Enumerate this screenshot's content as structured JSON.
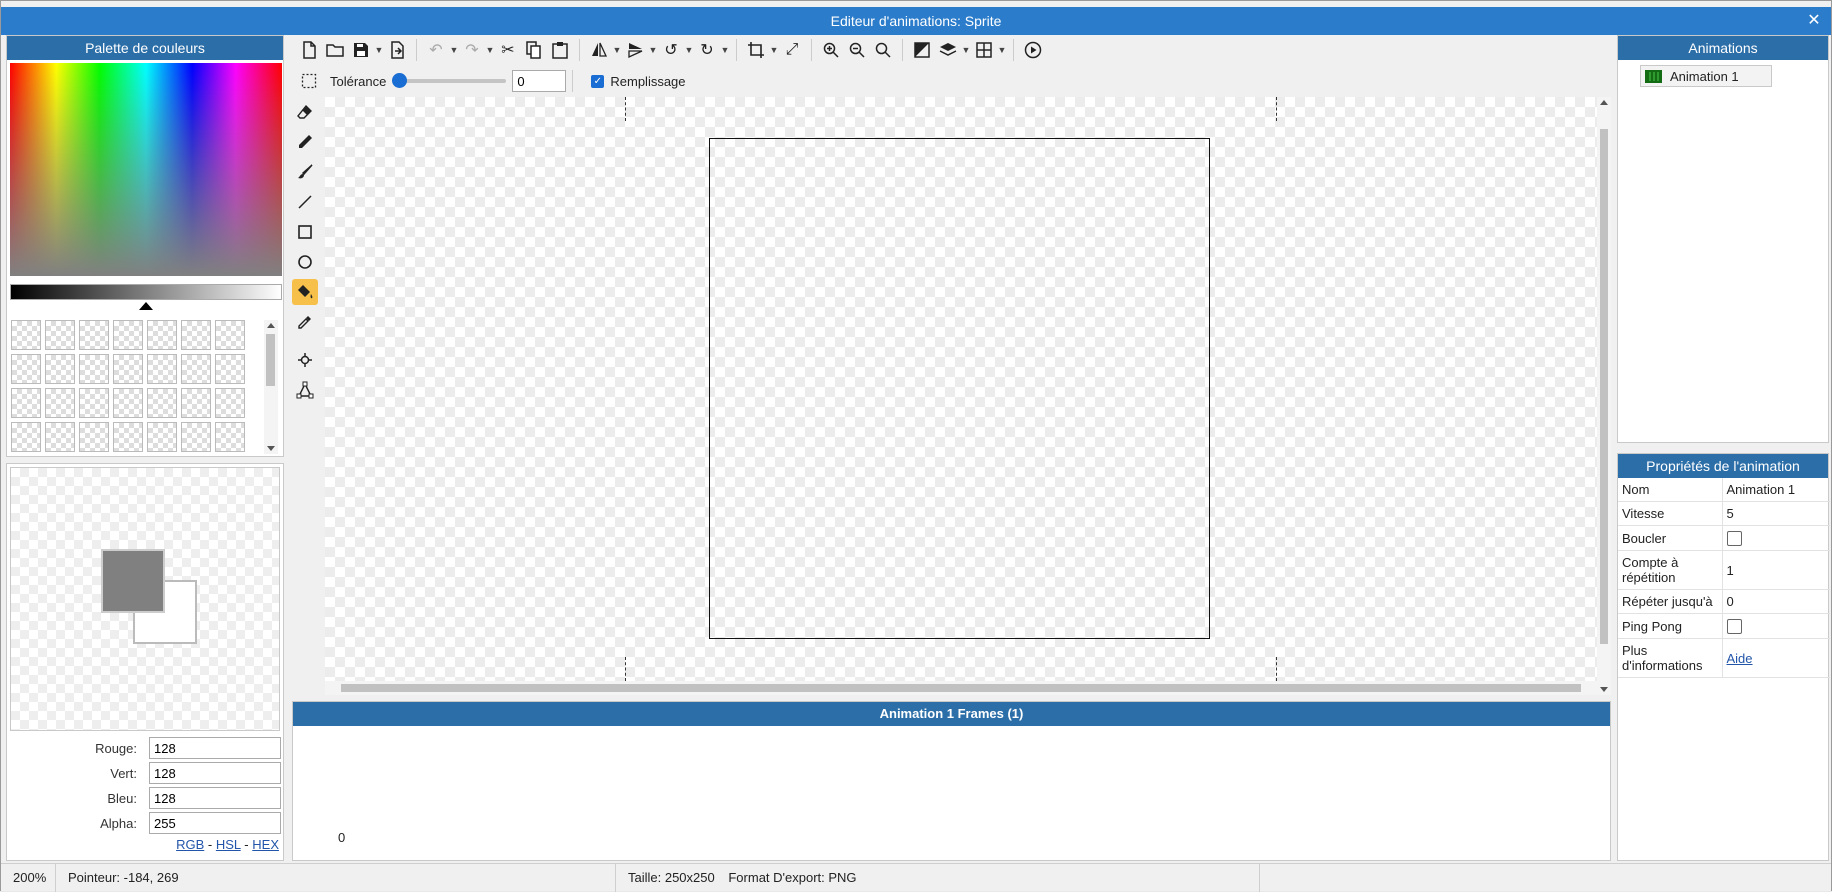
{
  "window": {
    "title": "Editeur d'animations: Sprite",
    "close": "✕"
  },
  "palette": {
    "title": "Palette de couleurs",
    "swatch_count": 28,
    "fields": [
      {
        "label": "Rouge:",
        "value": "128"
      },
      {
        "label": "Vert:",
        "value": "128"
      },
      {
        "label": "Bleu:",
        "value": "128"
      },
      {
        "label": "Alpha:",
        "value": "255"
      }
    ],
    "modes": {
      "rgb": "RGB",
      "hsl": "HSL",
      "hex": "HEX",
      "sep": "-"
    },
    "foreground_color": "#808080",
    "background_color": "#ffffff"
  },
  "toolbar": {
    "tolerance_label": "Tolérance",
    "tolerance_value": "0",
    "tolerance_fraction": 0,
    "fill_label": "Remplissage",
    "fill_checked": true
  },
  "frames": {
    "title": "Animation 1 Frames (1)",
    "index": "0"
  },
  "animations": {
    "title": "Animations",
    "items": [
      {
        "label": "Animation 1"
      }
    ]
  },
  "properties": {
    "title": "Propriétés de l'animation",
    "rows": {
      "name": {
        "key": "Nom",
        "value": "Animation 1"
      },
      "speed": {
        "key": "Vitesse",
        "value": "5"
      },
      "loop": {
        "key": "Boucler",
        "checked": false
      },
      "repeat_count": {
        "key": "Compte à répétition",
        "value": "1"
      },
      "repeat_until": {
        "key": "Répéter jusqu'à",
        "value": "0"
      },
      "ping_pong": {
        "key": "Ping Pong",
        "checked": false
      },
      "more_info": {
        "key": "Plus d'informations",
        "link": "Aide"
      }
    }
  },
  "status": {
    "zoom": "200%",
    "pointer": "Pointeur: -184, 269",
    "size": "Taille: 250x250",
    "export": "Format D'export: PNG"
  },
  "colors": {
    "titlebar": "#2b7ccb",
    "panel_header": "#2b6ea8",
    "active_tool": "#f6c04a",
    "accent": "#1a6dd2"
  }
}
